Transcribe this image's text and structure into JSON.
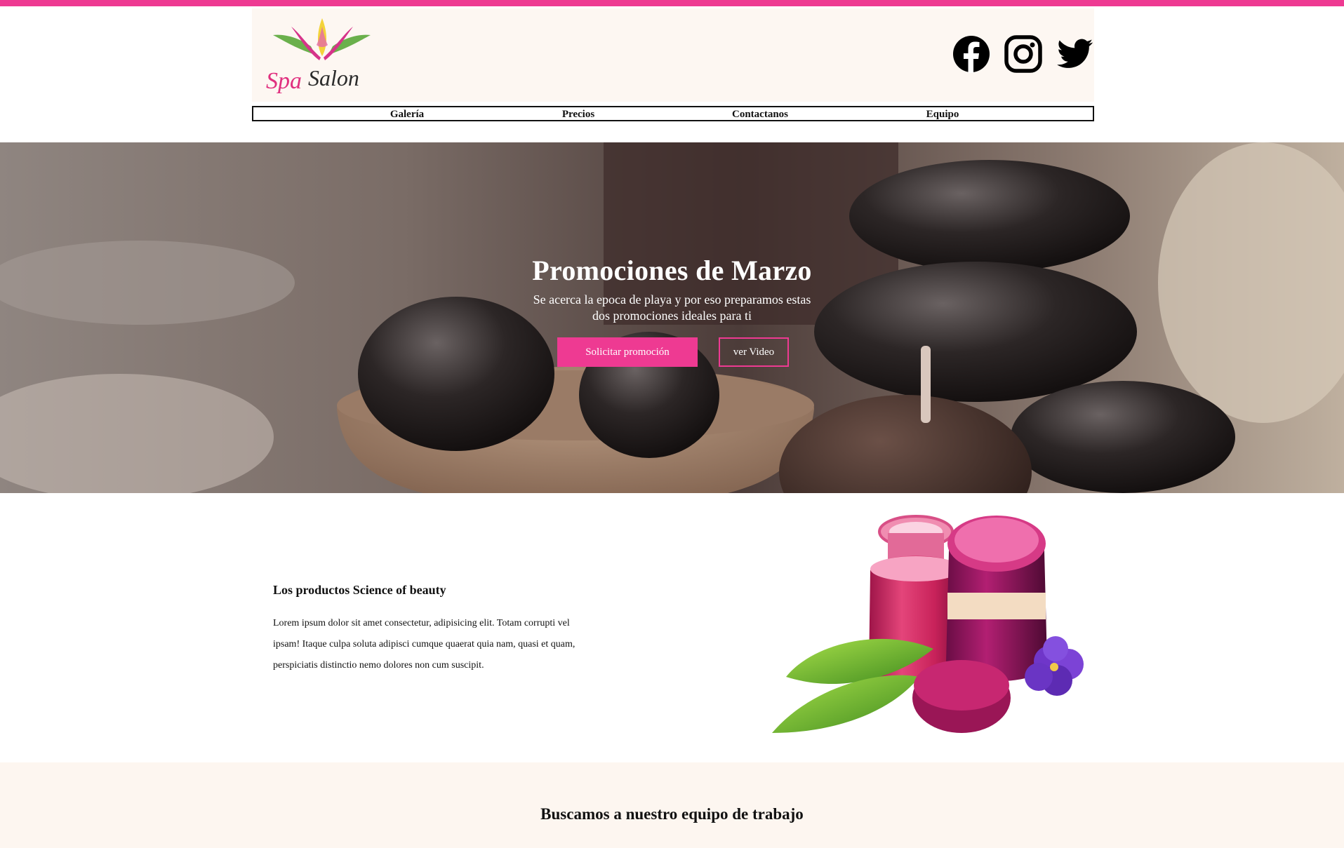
{
  "colors": {
    "accent": "#ee3a92",
    "header_bg": "#fdf7f2",
    "section_bg": "#fdf6f0"
  },
  "brand": {
    "logo_word1": "Spa",
    "logo_word2": "Salon"
  },
  "social": [
    {
      "name": "facebook-icon"
    },
    {
      "name": "instagram-icon"
    },
    {
      "name": "twitter-icon"
    }
  ],
  "nav": {
    "items": [
      {
        "label": "Galería"
      },
      {
        "label": "Precios"
      },
      {
        "label": "Contactanos"
      },
      {
        "label": "Equipo"
      }
    ]
  },
  "hero": {
    "title": "Promociones de Marzo",
    "subtitle": "Se acerca la epoca de playa y por eso preparamos estas dos promociones ideales para ti",
    "primary_button": "Solicitar promoción",
    "secondary_button": "ver Video"
  },
  "products": {
    "heading": "Los productos Science of beauty",
    "body": "Lorem ipsum dolor sit amet consectetur, adipisicing elit. Totam corrupti vel ipsam! Itaque culpa soluta adipisci cumque quaerat quia nam, quasi et quam, perspiciatis distinctio nemo dolores non cum suscipit."
  },
  "team": {
    "heading": "Buscamos a nuestro equipo de trabajo"
  }
}
